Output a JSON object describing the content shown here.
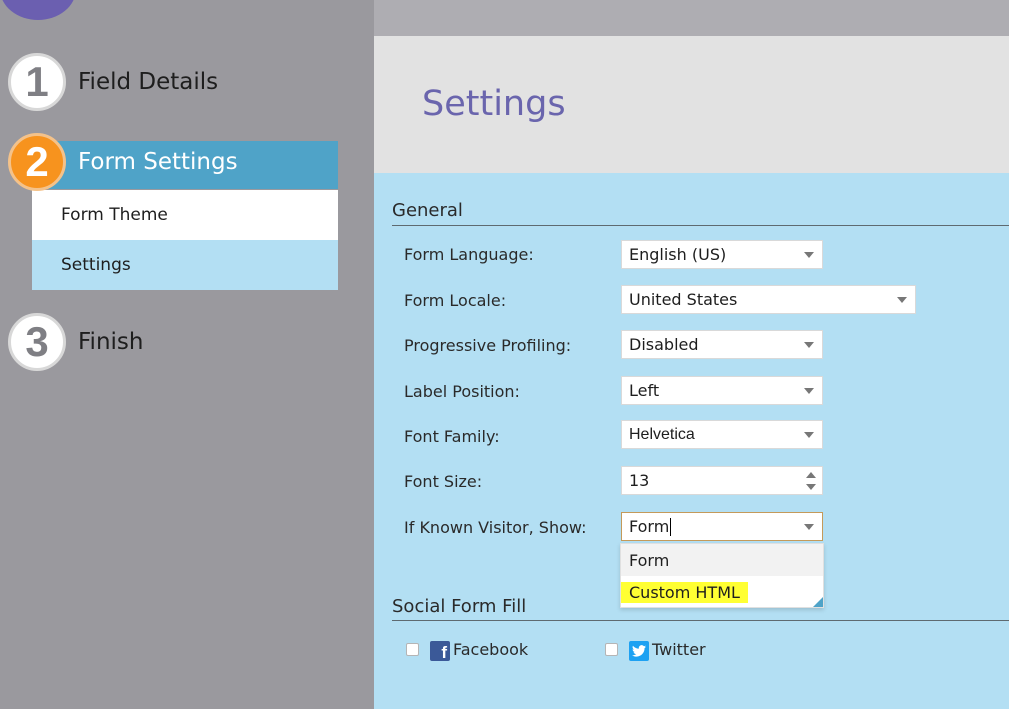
{
  "wizard": {
    "steps": [
      {
        "number": "1",
        "label": "Field Details"
      },
      {
        "number": "2",
        "label": "Form Settings"
      },
      {
        "number": "3",
        "label": "Finish"
      }
    ],
    "substeps": [
      {
        "label": "Form Theme"
      },
      {
        "label": "Settings"
      }
    ]
  },
  "page": {
    "title": "Settings"
  },
  "general": {
    "title": "General",
    "fields": [
      {
        "label": "Form Language:",
        "value": "English (US)"
      },
      {
        "label": "Form Locale:",
        "value": "United States"
      },
      {
        "label": "Progressive Profiling:",
        "value": "Disabled"
      },
      {
        "label": "Label Position:",
        "value": "Left"
      },
      {
        "label": "Font Family:",
        "value": "Helvetica"
      },
      {
        "label": "Font Size:",
        "value": "13"
      },
      {
        "label": "If Known Visitor, Show:",
        "value": "Form"
      }
    ],
    "known_visitor_options": [
      "Form",
      "Custom HTML"
    ]
  },
  "social": {
    "title": "Social Form Fill",
    "options": [
      {
        "label": "Facebook",
        "icon": "facebook-icon"
      },
      {
        "label": "Twitter",
        "icon": "twitter-icon"
      }
    ]
  },
  "colors": {
    "accent_blue": "#4fa3c8",
    "step_active": "#f7931e",
    "title_purple": "#6a65ad",
    "panel_bg": "#b3dff3",
    "highlight": "#ffff33"
  }
}
